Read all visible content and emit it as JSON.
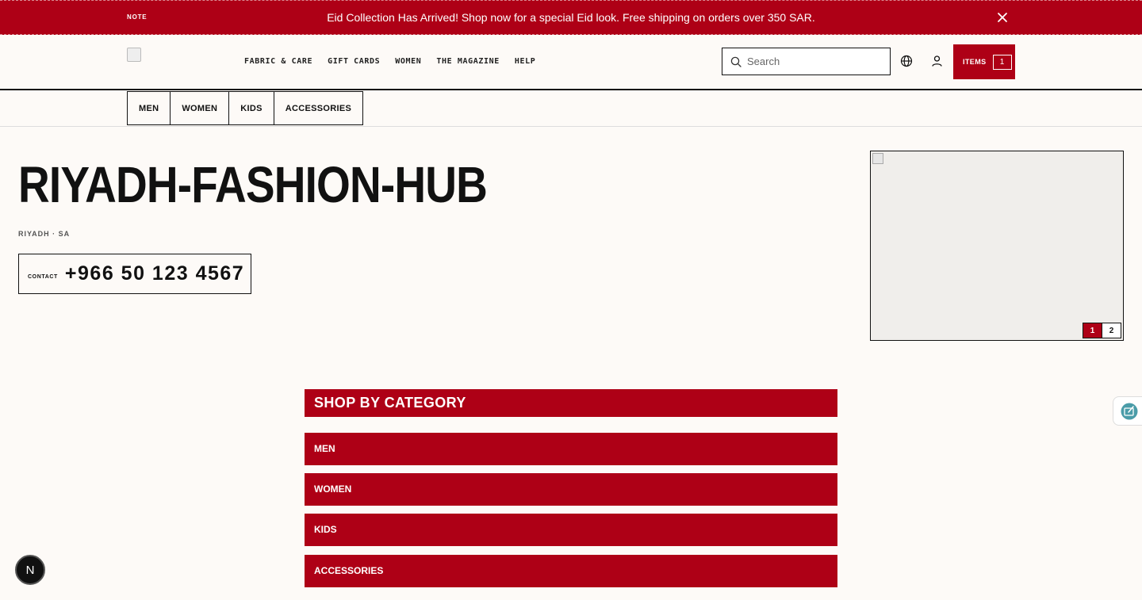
{
  "announcement": {
    "note": "NOTE",
    "message": "Eid Collection Has Arrived! Shop now for a special Eid look. Free shipping on orders over 350 SAR."
  },
  "header": {
    "nav": [
      "FABRIC & CARE",
      "GIFT CARDS",
      "WOMEN",
      "THE MAGAZINE",
      "HELP"
    ],
    "search_placeholder": "Search",
    "cart_label": "ITEMS",
    "cart_count": "1"
  },
  "subnav": [
    "MEN",
    "WOMEN",
    "KIDS",
    "ACCESSORIES"
  ],
  "store": {
    "name": "RIYADH-FASHION-HUB",
    "location": "RIYADH · SA",
    "contact_label": "CONTACT",
    "phone": "+966 50 123 4567"
  },
  "carousel": {
    "pages": [
      "1",
      "2"
    ],
    "active_page": "1"
  },
  "categories": {
    "heading": "SHOP BY CATEGORY",
    "items": [
      "MEN",
      "WOMEN",
      "KIDS",
      "ACCESSORIES"
    ]
  },
  "floating": {
    "badge": "N"
  },
  "colors": {
    "brand_red": "#ae0016",
    "background": "#fdfaf7",
    "ink": "#111111"
  }
}
